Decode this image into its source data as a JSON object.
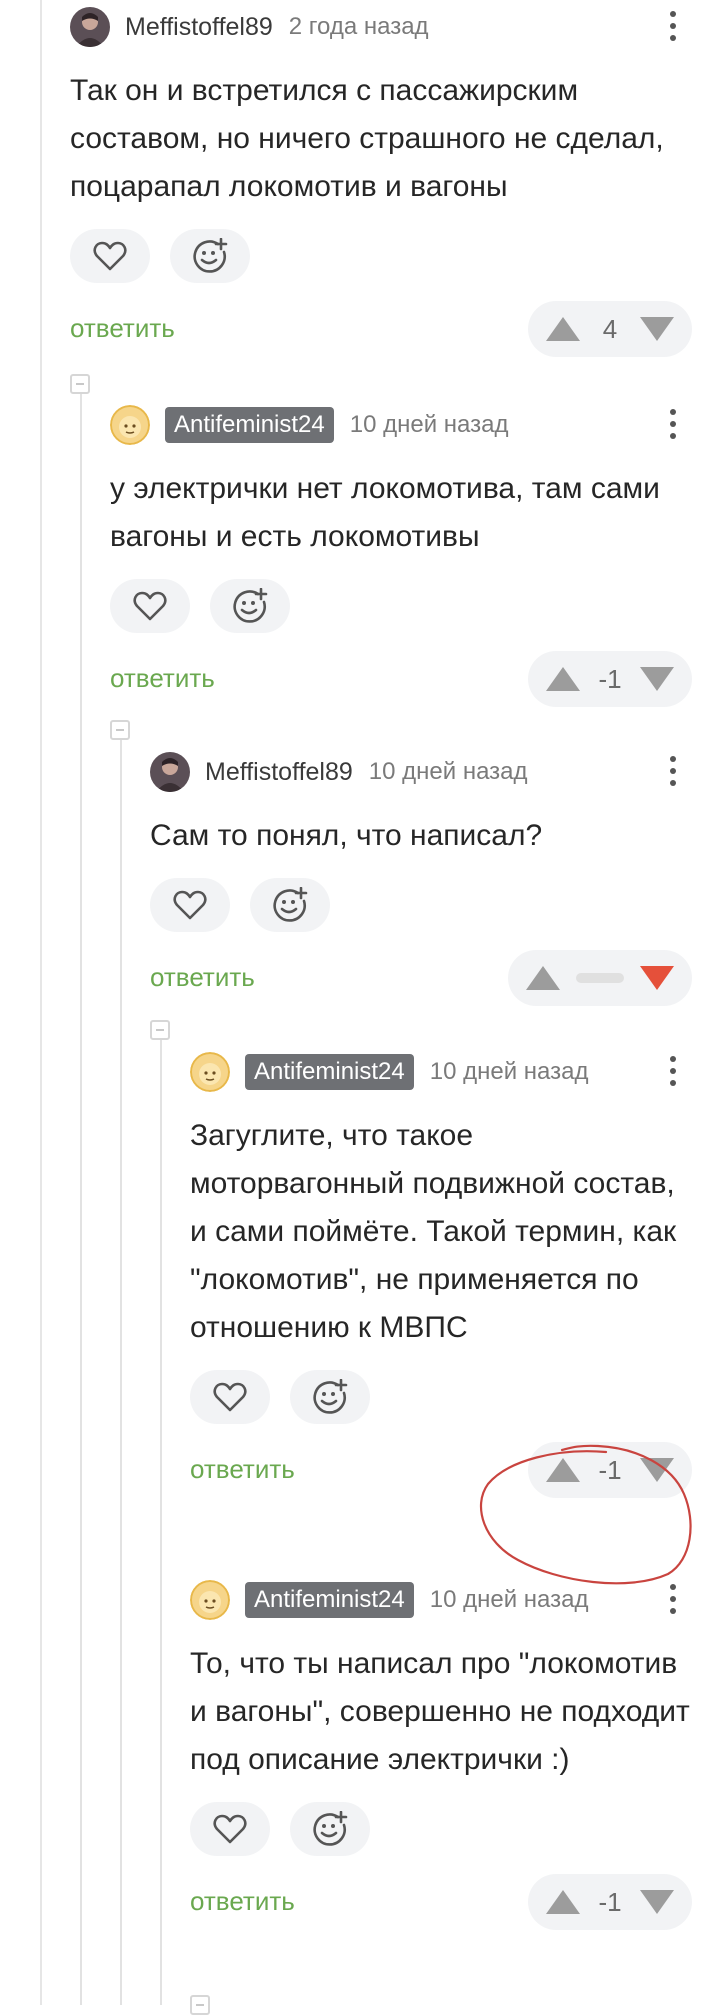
{
  "colors": {
    "accent_green": "#6aa84f",
    "downvote_active": "#e5503a",
    "badge_bg": "#6e7074",
    "annotation_red": "#c9443f"
  },
  "actions": {
    "reply_label": "ответить",
    "like_icon": "heart-icon",
    "react_icon": "add-emoji-icon"
  },
  "comments": [
    {
      "author": "Meffistoffel89",
      "time": "2 года назад",
      "text": "Так он и встретился с пассажирским составом, но ничего страшного не сделал, поцарапал локомотив и вагоны",
      "score": "4"
    },
    {
      "author": "Antifeminist24",
      "time": "10 дней назад",
      "text": "у электрички нет локомотива, там сами вагоны и есть локомотивы",
      "score": "-1"
    },
    {
      "author": "Meffistoffel89",
      "time": "10 дней назад",
      "text": "Сам то понял, что написал?",
      "score": ""
    },
    {
      "author": "Antifeminist24",
      "time": "10 дней назад",
      "text": "Загуглите, что такое моторвагонный подвижной состав, и сами поймёте. Такой термин, как \"локомотив\", не применяется по отношению к МВПС",
      "score": "-1"
    },
    {
      "author": "Antifeminist24",
      "time": "10 дней назад",
      "text": "То, что ты написал про \"локомотив и вагоны\", совершенно не подходит под описание электрички :)",
      "score": "-1"
    }
  ]
}
